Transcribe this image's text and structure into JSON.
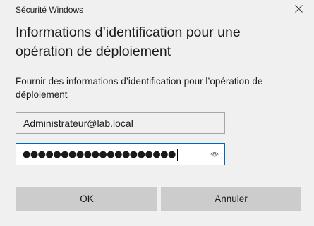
{
  "window": {
    "title": "Sécurité Windows",
    "close_icon": "close-icon"
  },
  "dialog": {
    "heading": "Informations d’identification pour une opération de déploiement",
    "description": "Fournir des informations d’identification pour l’opération de déploiement"
  },
  "username": {
    "value": "Administrateur@lab.local"
  },
  "password": {
    "masked_value": "●●●●●●●●●●●●●●●●●●●●",
    "reveal_icon": "eye-icon"
  },
  "buttons": {
    "ok_label": "OK",
    "cancel_label": "Annuler"
  },
  "colors": {
    "background": "#f0f0f0",
    "button": "#cccccc",
    "focus_border": "#0067c0"
  }
}
